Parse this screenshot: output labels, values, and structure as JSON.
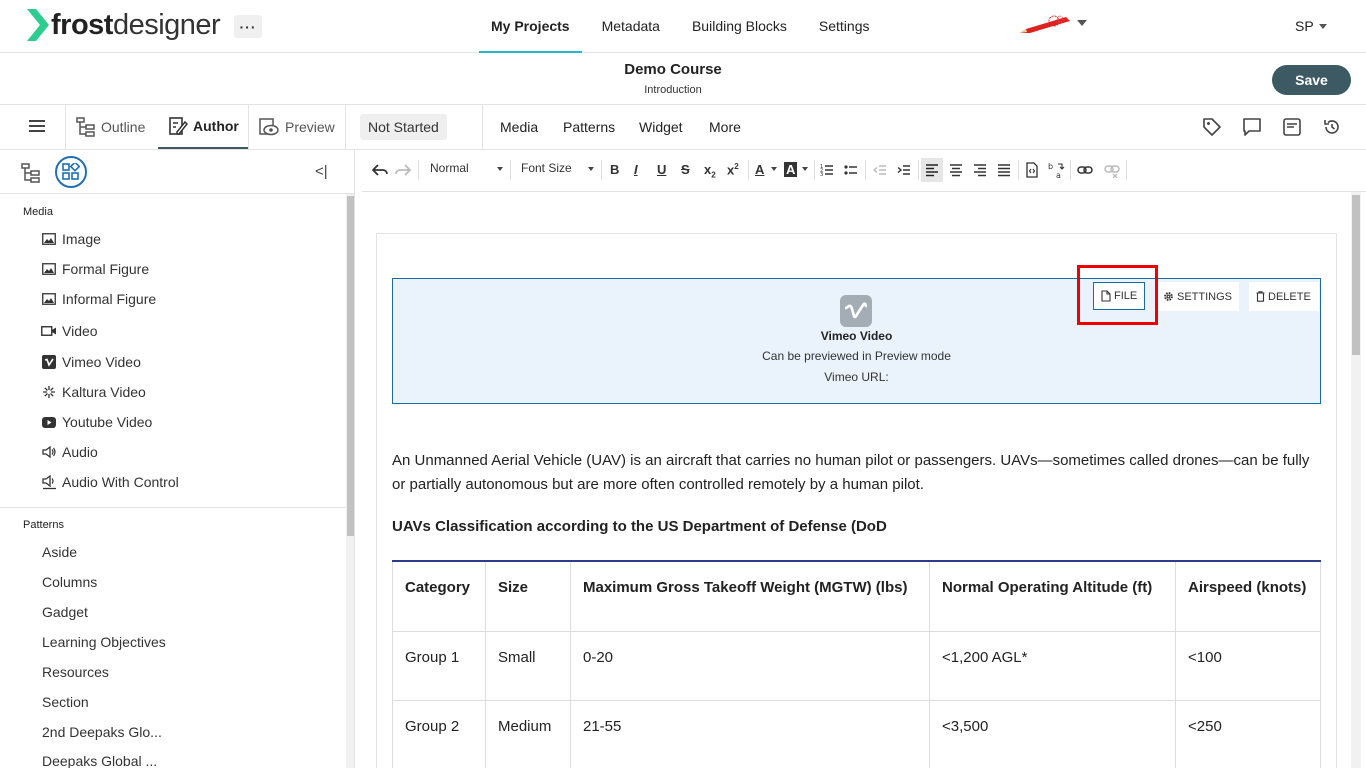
{
  "app": {
    "brand_bold": "frost",
    "brand_light": "designer",
    "more_label": "···",
    "nav": [
      "My Projects",
      "Metadata",
      "Building Blocks",
      "Settings"
    ],
    "user_initials": "SP",
    "accent": "#28b5c9",
    "logo_color": "#2ecc8f"
  },
  "course": {
    "title": "Demo Course",
    "subtitle": "Introduction",
    "save_label": "Save"
  },
  "modes": {
    "outline": "Outline",
    "author": "Author",
    "preview": "Preview",
    "status": "Not Started",
    "menus": [
      "Media",
      "Patterns",
      "Widget",
      "More"
    ],
    "right_icons": [
      "tag-icon",
      "comment-icon",
      "panel-icon",
      "history-icon"
    ]
  },
  "leftpanel": {
    "media_title": "Media",
    "media_items": [
      {
        "label": "Image",
        "icon": "image-icon"
      },
      {
        "label": "Formal Figure",
        "icon": "image-icon"
      },
      {
        "label": "Informal Figure",
        "icon": "image-icon"
      },
      {
        "label": "Video",
        "icon": "video-icon"
      },
      {
        "label": "Vimeo Video",
        "icon": "vimeo-icon"
      },
      {
        "label": "Kaltura Video",
        "icon": "kaltura-icon"
      },
      {
        "label": "Youtube Video",
        "icon": "youtube-icon"
      },
      {
        "label": "Audio",
        "icon": "audio-icon"
      },
      {
        "label": "Audio With Control",
        "icon": "audio-control-icon"
      }
    ],
    "patterns_title": "Patterns",
    "pattern_items": [
      "Aside",
      "Columns",
      "Gadget",
      "Learning Objectives",
      "Resources",
      "Section",
      "2nd Deepaks Glo...",
      "Deepaks Global ..."
    ]
  },
  "toolbar": {
    "format": "Normal",
    "font_size": "Font Size"
  },
  "video_block": {
    "title": "Vimeo Video",
    "line1": "Can be previewed in Preview mode",
    "line2": "Vimeo URL:",
    "file_label": "FILE",
    "settings_label": "SETTINGS",
    "delete_label": "DELETE"
  },
  "content": {
    "paragraph": "An Unmanned Aerial Vehicle (UAV) is an aircraft that carries no human pilot or passengers. UAVs—sometimes called drones—can be fully or partially autonomous but are more often controlled remotely by a human pilot.",
    "subheading": "UAVs Classification according to the US Department of Defense (DoD",
    "table": {
      "headers": [
        "Category",
        "Size",
        "Maximum Gross Takeoff Weight (MGTW) (lbs)",
        "Normal Operating Altitude (ft)",
        "Airspeed (knots)"
      ],
      "rows": [
        [
          "Group 1",
          "Small",
          "0-20",
          "<1,200 AGL*",
          "<100"
        ],
        [
          "Group 2",
          "Medium",
          "21-55",
          "<3,500",
          "<250"
        ]
      ]
    }
  }
}
